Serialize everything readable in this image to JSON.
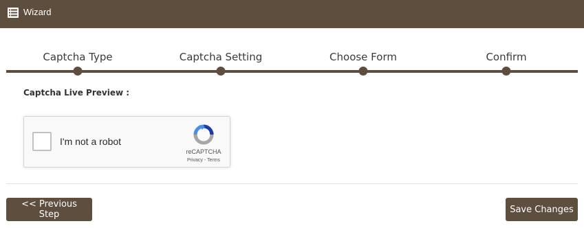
{
  "header": {
    "icon": "list-icon",
    "title": "Wizard"
  },
  "steps": [
    {
      "label": "Captcha Type"
    },
    {
      "label": "Captcha Setting"
    },
    {
      "label": "Choose Form"
    },
    {
      "label": "Confirm"
    }
  ],
  "preview": {
    "label": "Captcha Live Preview :"
  },
  "recaptcha": {
    "checkbox_label": "I'm not a robot",
    "brand": "reCAPTCHA",
    "privacy_link": "Privacy",
    "separator": " - ",
    "terms_link": "Terms",
    "logo_icon": "recaptcha-logo-icon"
  },
  "buttons": {
    "previous": "<< Previous Step",
    "save": "Save Changes"
  },
  "colors": {
    "brand": "#5e4e3e",
    "header_text": "#ffffff"
  }
}
